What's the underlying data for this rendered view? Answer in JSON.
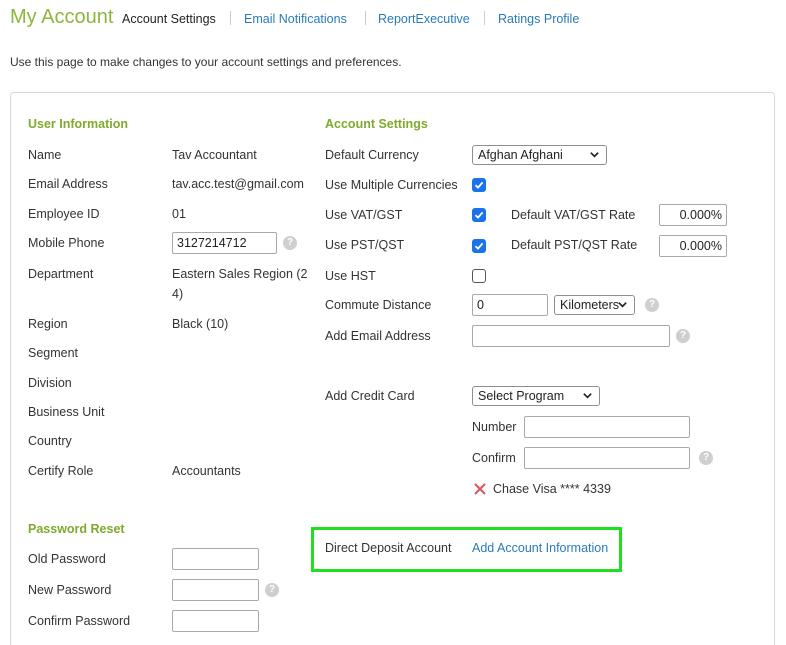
{
  "header": {
    "title": "My Account",
    "tabs": [
      {
        "label": "Account Settings",
        "active": true
      },
      {
        "label": "Email Notifications",
        "active": false
      },
      {
        "label": "ReportExecutive",
        "active": false
      },
      {
        "label": "Ratings Profile",
        "active": false
      }
    ],
    "intro": "Use this page to make changes to your account settings and preferences."
  },
  "user_info": {
    "title": "User Information",
    "name_label": "Name",
    "name_value": "Tav Accountant",
    "email_label": "Email Address",
    "email_value": "tav.acc.test@gmail.com",
    "employee_label": "Employee ID",
    "employee_value": "01",
    "mobile_label": "Mobile Phone",
    "mobile_value": "3127214712",
    "department_label": "Department",
    "department_value_1": "Eastern Sales Region (2",
    "department_value_2": "4)",
    "region_label": "Region",
    "region_value": "Black (10)",
    "segment_label": "Segment",
    "division_label": "Division",
    "business_unit_label": "Business Unit",
    "country_label": "Country",
    "certify_label": "Certify Role",
    "certify_value": "Accountants"
  },
  "password_reset": {
    "title": "Password Reset",
    "old_label": "Old Password",
    "new_label": "New Password",
    "confirm_label": "Confirm Password"
  },
  "account_settings": {
    "title": "Account Settings",
    "currency_label": "Default Currency",
    "currency_value": "Afghan Afghani",
    "multi_currency_label": "Use Multiple Currencies",
    "multi_currency_checked": true,
    "vat_label": "Use VAT/GST",
    "vat_checked": true,
    "vat_rate_label": "Default VAT/GST Rate",
    "vat_rate_value": "0.000%",
    "pst_label": "Use PST/QST",
    "pst_checked": true,
    "pst_rate_label": "Default PST/QST Rate",
    "pst_rate_value": "0.000%",
    "hst_label": "Use HST",
    "hst_checked": false,
    "commute_label": "Commute Distance",
    "commute_value": "0",
    "commute_unit": "Kilometers",
    "add_email_label": "Add Email Address",
    "add_email_value": "",
    "credit_card_label": "Add Credit Card",
    "program_value": "Select Program",
    "number_label": "Number",
    "confirm_label": "Confirm",
    "existing_card": "Chase Visa **** 4339",
    "direct_deposit_label": "Direct Deposit Account",
    "direct_deposit_link": "Add Account Information"
  },
  "icons": {
    "help": "help-icon",
    "delete": "close-icon",
    "checkbox": "checkmark-icon"
  },
  "colors": {
    "accent_green": "#8cb63c",
    "link_blue": "#2a7ab8",
    "checkbox_blue": "#1a73e8",
    "highlight": "#1fe01f",
    "delete_red": "#e05555"
  }
}
